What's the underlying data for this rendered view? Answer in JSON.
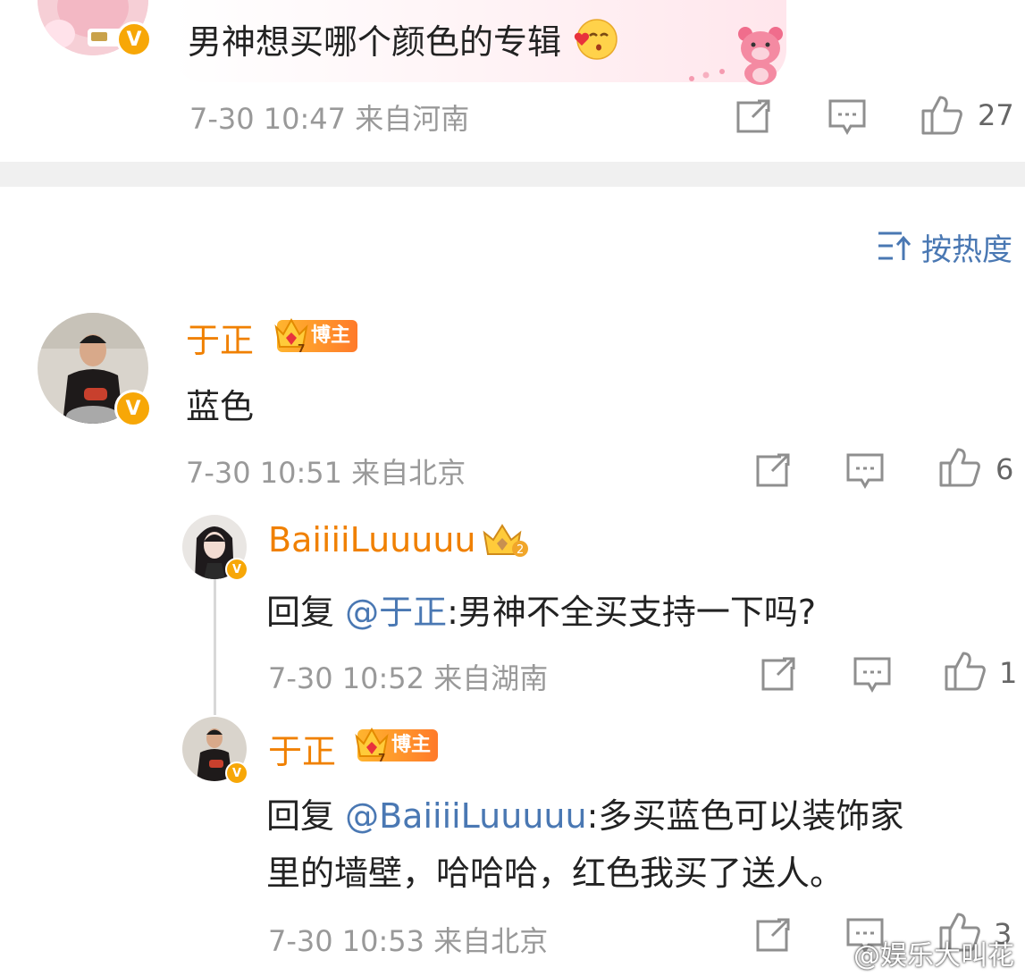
{
  "top_comment": {
    "text": "男神想买哪个颜色的专辑",
    "emoji": "kissing-face-emoji",
    "time": "7-30 10:47",
    "location": "来自河南",
    "likes": "27"
  },
  "sort": {
    "label": "按热度",
    "icon": "sort-icon"
  },
  "comments": [
    {
      "username": "于正",
      "badge": "博主",
      "text": "蓝色",
      "time": "7-30 10:51",
      "location": "来自北京",
      "likes": "6"
    }
  ],
  "replies": [
    {
      "username": "BaiiiiLuuuuu",
      "badge_level": "2",
      "prefix": "回复 ",
      "mention": "@于正",
      "text": ":男神不全买支持一下吗?",
      "time": "7-30 10:52",
      "location": "来自湖南",
      "likes": "1"
    },
    {
      "username": "于正",
      "badge": "博主",
      "prefix": "回复 ",
      "mention": "@BaiiiiLuuuuu",
      "text_line1": ":多买蓝色可以装饰家",
      "text_line2": "里的墙壁，哈哈哈，红色我买了送人。",
      "time": "7-30 10:53",
      "location": "来自北京",
      "likes": "3"
    }
  ],
  "watermark": "@娱乐大叫花",
  "colors": {
    "username": "#f08000",
    "mention": "#4a78b3",
    "meta": "#999999",
    "badge": "#f7a707"
  }
}
